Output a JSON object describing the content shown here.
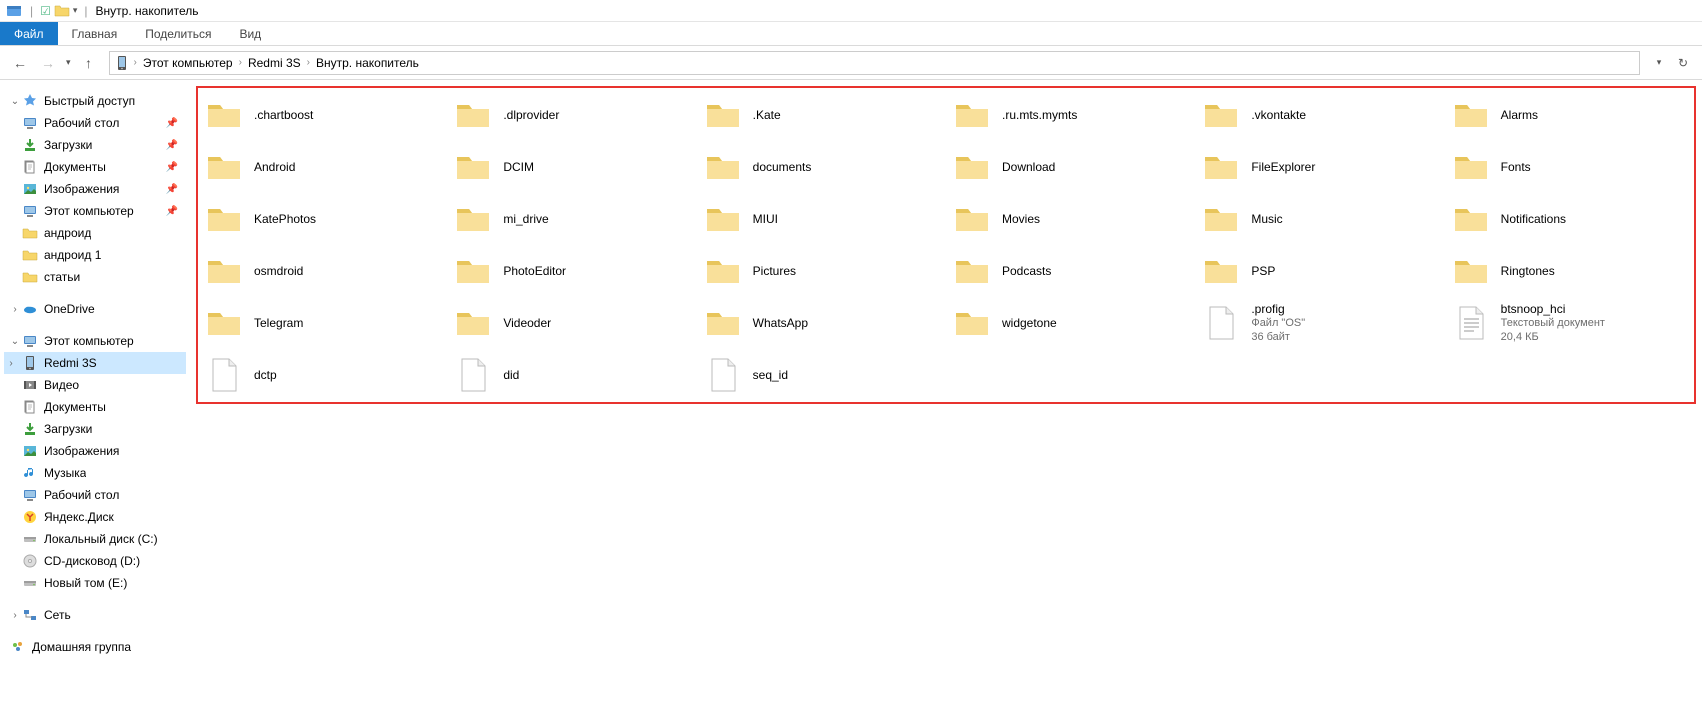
{
  "window": {
    "title": "Внутр. накопитель"
  },
  "ribbon": {
    "file": "Файл",
    "home": "Главная",
    "share": "Поделиться",
    "view": "Вид"
  },
  "breadcrumbs": [
    {
      "label": "Этот компьютер"
    },
    {
      "label": "Redmi 3S"
    },
    {
      "label": "Внутр. накопитель"
    }
  ],
  "sidebar": {
    "quick_access": {
      "label": "Быстрый доступ",
      "items": [
        {
          "label": "Рабочий стол",
          "icon": "desktop",
          "pinned": true
        },
        {
          "label": "Загрузки",
          "icon": "downloads",
          "pinned": true
        },
        {
          "label": "Документы",
          "icon": "documents",
          "pinned": true
        },
        {
          "label": "Изображения",
          "icon": "pictures",
          "pinned": true
        },
        {
          "label": "Этот компьютер",
          "icon": "pc",
          "pinned": true
        },
        {
          "label": "андроид",
          "icon": "folder",
          "pinned": false
        },
        {
          "label": "андроид 1",
          "icon": "folder",
          "pinned": false
        },
        {
          "label": "статьи",
          "icon": "folder",
          "pinned": false
        }
      ]
    },
    "onedrive": {
      "label": "OneDrive"
    },
    "this_pc": {
      "label": "Этот компьютер",
      "items": [
        {
          "label": "Redmi 3S",
          "icon": "phone",
          "selected": true
        },
        {
          "label": "Видео",
          "icon": "videos"
        },
        {
          "label": "Документы",
          "icon": "documents"
        },
        {
          "label": "Загрузки",
          "icon": "downloads"
        },
        {
          "label": "Изображения",
          "icon": "pictures"
        },
        {
          "label": "Музыка",
          "icon": "music"
        },
        {
          "label": "Рабочий стол",
          "icon": "desktop"
        },
        {
          "label": "Яндекс.Диск",
          "icon": "yadisk"
        },
        {
          "label": "Локальный диск (C:)",
          "icon": "drive"
        },
        {
          "label": "CD-дисковод (D:)",
          "icon": "cd"
        },
        {
          "label": "Новый том (E:)",
          "icon": "drive"
        }
      ]
    },
    "network": {
      "label": "Сеть"
    },
    "homegroup": {
      "label": "Домашняя группа"
    }
  },
  "items": [
    {
      "name": ".chartboost",
      "type": "folder"
    },
    {
      "name": ".dlprovider",
      "type": "folder"
    },
    {
      "name": ".Kate",
      "type": "folder"
    },
    {
      "name": ".ru.mts.mymts",
      "type": "folder"
    },
    {
      "name": ".vkontakte",
      "type": "folder"
    },
    {
      "name": "Alarms",
      "type": "folder"
    },
    {
      "name": "Android",
      "type": "folder"
    },
    {
      "name": "DCIM",
      "type": "folder"
    },
    {
      "name": "documents",
      "type": "folder"
    },
    {
      "name": "Download",
      "type": "folder"
    },
    {
      "name": "FileExplorer",
      "type": "folder"
    },
    {
      "name": "Fonts",
      "type": "folder"
    },
    {
      "name": "KatePhotos",
      "type": "folder"
    },
    {
      "name": "mi_drive",
      "type": "folder"
    },
    {
      "name": "MIUI",
      "type": "folder"
    },
    {
      "name": "Movies",
      "type": "folder"
    },
    {
      "name": "Music",
      "type": "folder"
    },
    {
      "name": "Notifications",
      "type": "folder"
    },
    {
      "name": "osmdroid",
      "type": "folder"
    },
    {
      "name": "PhotoEditor",
      "type": "folder"
    },
    {
      "name": "Pictures",
      "type": "folder"
    },
    {
      "name": "Podcasts",
      "type": "folder"
    },
    {
      "name": "PSP",
      "type": "folder"
    },
    {
      "name": "Ringtones",
      "type": "folder"
    },
    {
      "name": "Telegram",
      "type": "folder"
    },
    {
      "name": "Videoder",
      "type": "folder"
    },
    {
      "name": "WhatsApp",
      "type": "folder"
    },
    {
      "name": "widgetone",
      "type": "folder"
    },
    {
      "name": ".profig",
      "type": "file",
      "sub1": "Файл \"OS\"",
      "sub2": "36 байт"
    },
    {
      "name": "btsnoop_hci",
      "type": "textfile",
      "sub1": "Текстовый документ",
      "sub2": "20,4 КБ"
    },
    {
      "name": "dctp",
      "type": "file"
    },
    {
      "name": "did",
      "type": "file"
    },
    {
      "name": "seq_id",
      "type": "file"
    }
  ]
}
